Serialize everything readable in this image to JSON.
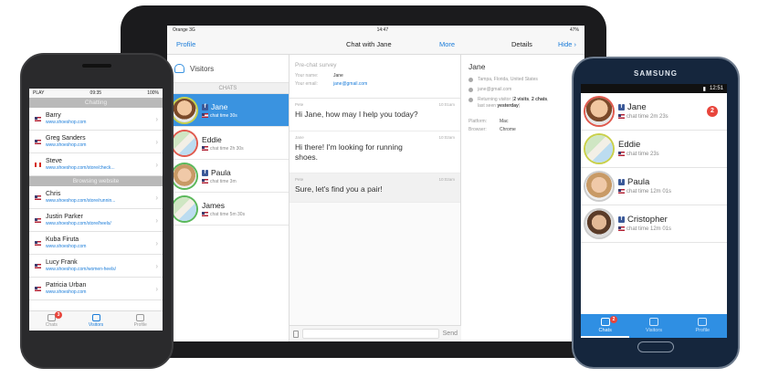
{
  "ipad": {
    "status": {
      "carrier": "Orange",
      "network": "3G",
      "time": "14:47",
      "battery": "47%"
    },
    "nav": {
      "left": "Profile",
      "title": "Chat with Jane",
      "more": "More",
      "details": "Details",
      "hide": "Hide"
    },
    "visitors_title": "Visitors",
    "chats_header": "CHATS",
    "chats": [
      {
        "name": "Jane",
        "sub": "chat time 30s",
        "fb": true
      },
      {
        "name": "Eddie",
        "sub": "chat time 2h 30s",
        "fb": false
      },
      {
        "name": "Paula",
        "sub": "chat time 3m",
        "fb": true
      },
      {
        "name": "James",
        "sub": "chat time 5m 30s",
        "fb": false
      }
    ],
    "prechat": {
      "title": "Pre-chat survey",
      "name_label": "Your name:",
      "name_value": "Jane",
      "email_label": "Your email:",
      "email_value": "jane@gmail.com"
    },
    "messages": [
      {
        "who": "Pete",
        "time": "10:01am",
        "text": "Hi Jane, how may I help you today?",
        "style": "white"
      },
      {
        "who": "Jane",
        "time": "10:02am",
        "text": "Hi there! I'm looking for running shoes.",
        "style": "white"
      },
      {
        "who": "Pete",
        "time": "10:02am",
        "text": "Sure, let's find you a pair!",
        "style": "grey"
      }
    ],
    "compose": {
      "send": "Send"
    },
    "details": {
      "name": "Jane",
      "location": "Tampa, Florida, United States",
      "email": "jane@gmail.com",
      "returning": "Returning visitor (",
      "visits": "2 visits",
      "sep": ", ",
      "chats": "2 chats",
      "comma": ",",
      "last_seen": "last seen ",
      "yesterday": "yesterday",
      "close": ")",
      "platform_label": "Platform:",
      "platform_value": "Mac",
      "browser_label": "Browser:",
      "browser_value": "Chrome"
    }
  },
  "iphone": {
    "status": {
      "carrier": "PLAY",
      "time": "09:35",
      "battery": "100%"
    },
    "section_chatting": "Chatting",
    "chatting": [
      {
        "name": "Barry",
        "url": "www.shoeshop.com",
        "flag": "us"
      },
      {
        "name": "Greg Sanders",
        "url": "www.shoeshop.com",
        "flag": "us"
      },
      {
        "name": "Steve",
        "url": "www.shoeshop.com/store/check...",
        "flag": "ca"
      }
    ],
    "section_browsing": "Browsing website",
    "browsing": [
      {
        "name": "Chris",
        "url": "www.shoeshop.com/store/runnin...",
        "flag": "us"
      },
      {
        "name": "Justin Parker",
        "url": "www.shoeshop.com/store/heels/",
        "flag": "us"
      },
      {
        "name": "Kuba Firuta",
        "url": "www.shoeshop.com",
        "flag": "us"
      },
      {
        "name": "Lucy Frank",
        "url": "www.shoeshop.com/women-heels/",
        "flag": "us"
      },
      {
        "name": "Patricia Urban",
        "url": "www.shoeshop.com",
        "flag": "us"
      }
    ],
    "tabs": {
      "chats": "Chats",
      "visitors": "Visitors",
      "profile": "Profile",
      "badge": "3"
    }
  },
  "samsung": {
    "brand": "SAMSUNG",
    "status": {
      "time": "12:51"
    },
    "chats": [
      {
        "name": "Jane",
        "sub": "chat time 2m 23s",
        "fb": true,
        "badge": "2"
      },
      {
        "name": "Eddie",
        "sub": "chat time 23s",
        "fb": false
      },
      {
        "name": "Paula",
        "sub": "chat time 12m 01s",
        "fb": true
      },
      {
        "name": "Cristopher",
        "sub": "chat time 12m 01s",
        "fb": true
      }
    ],
    "tabs": {
      "chats": "Chats",
      "visitors": "Visitors",
      "profile": "Profile",
      "badge": "2"
    }
  },
  "colors": {
    "accent": "#3a93e0",
    "link": "#1a7cd9",
    "badge": "#e8453c",
    "facebook": "#3b5998"
  }
}
